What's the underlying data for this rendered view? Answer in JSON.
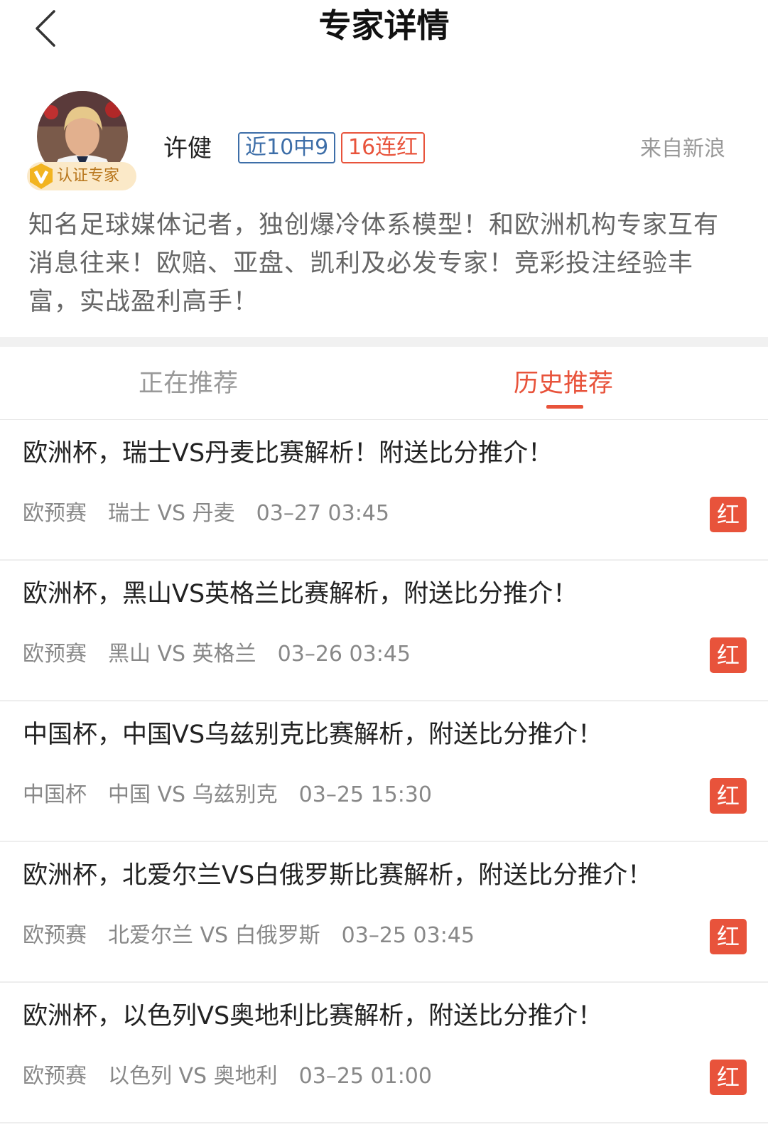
{
  "nav": {
    "title": "专家详情"
  },
  "expert": {
    "verify_label": "认证专家",
    "name": "许健",
    "tag_record": "近10中9",
    "tag_streak": "16连红",
    "source": "来自新浪",
    "bio": "知名足球媒体记者，独创爆冷体系模型！和欧洲机构专家互有消息往来！欧赔、亚盘、凯利及必发专家！竞彩投注经验丰富，实战盈利高手！"
  },
  "tabs": {
    "current": "正在推荐",
    "history": "历史推荐"
  },
  "items": [
    {
      "title": "欧洲杯，瑞士VS丹麦比赛解析！附送比分推介！",
      "league": "欧预赛",
      "match": "瑞士 VS 丹麦",
      "time": "03–27 03:45",
      "result": "红"
    },
    {
      "title": "欧洲杯，黑山VS英格兰比赛解析，附送比分推介！",
      "league": "欧预赛",
      "match": "黑山 VS 英格兰",
      "time": "03–26 03:45",
      "result": "红"
    },
    {
      "title": "中国杯，中国VS乌兹别克比赛解析，附送比分推介！",
      "league": "中国杯",
      "match": "中国 VS 乌兹别克",
      "time": "03–25 15:30",
      "result": "红"
    },
    {
      "title": "欧洲杯，北爱尔兰VS白俄罗斯比赛解析，附送比分推介！",
      "league": "欧预赛",
      "match": "北爱尔兰 VS 白俄罗斯",
      "time": "03–25 03:45",
      "result": "红"
    },
    {
      "title": "欧洲杯，以色列VS奥地利比赛解析，附送比分推介！",
      "league": "欧预赛",
      "match": "以色列 VS 奥地利",
      "time": "03–25 01:00",
      "result": "红"
    }
  ]
}
